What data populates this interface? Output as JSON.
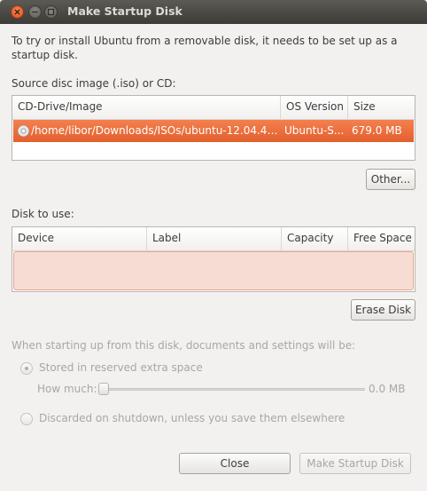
{
  "window": {
    "title": "Make Startup Disk"
  },
  "intro_text": "To try or install Ubuntu from a removable disk, it needs to be set up as a startup disk.",
  "source": {
    "label": "Source disc image (.iso) or CD:",
    "columns": [
      "CD-Drive/Image",
      "OS Version",
      "Size"
    ],
    "rows": [
      {
        "image": "/home/libor/Downloads/ISOs/ubuntu-12.04.4-s...",
        "os_version": "Ubuntu-S...",
        "size": "679.0 MB",
        "selected": true
      }
    ],
    "other_button": "Other..."
  },
  "disk": {
    "label": "Disk to use:",
    "columns": [
      "Device",
      "Label",
      "Capacity",
      "Free Space"
    ],
    "rows": [],
    "erase_button": "Erase Disk"
  },
  "options": {
    "heading": "When starting up from this disk, documents and settings will be:",
    "stored_label": "Stored in reserved extra space",
    "how_much_label": "How much:",
    "how_much_value": "0.0 MB",
    "slider_fraction": 0.0,
    "discard_label": "Discarded on shutdown, unless you save them elsewhere"
  },
  "buttons": {
    "close": "Close",
    "make": "Make Startup Disk"
  },
  "colors": {
    "selection": "#e9673a",
    "titlebar": "#3c3b37",
    "close_button": "#df4a16",
    "empty_list": "#f7dcd3"
  }
}
